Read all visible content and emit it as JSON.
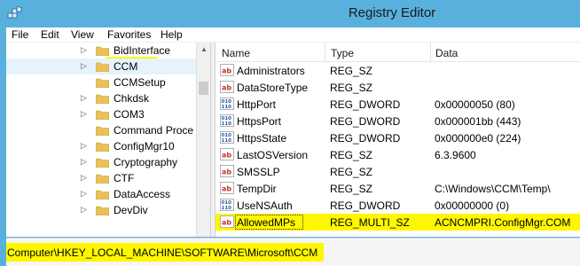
{
  "window": {
    "title": "Registry Editor"
  },
  "menu": [
    "File",
    "Edit",
    "View",
    "Favorites",
    "Help"
  ],
  "tree": {
    "items": [
      {
        "label": "BidInterface",
        "expandable": true,
        "selected": false
      },
      {
        "label": "CCM",
        "expandable": true,
        "selected": true
      },
      {
        "label": "CCMSetup",
        "expandable": false,
        "selected": false
      },
      {
        "label": "Chkdsk",
        "expandable": true,
        "selected": false
      },
      {
        "label": "COM3",
        "expandable": true,
        "selected": false
      },
      {
        "label": "Command Proce",
        "expandable": false,
        "selected": false
      },
      {
        "label": "ConfigMgr10",
        "expandable": true,
        "selected": false
      },
      {
        "label": "Cryptography",
        "expandable": true,
        "selected": false
      },
      {
        "label": "CTF",
        "expandable": true,
        "selected": false
      },
      {
        "label": "DataAccess",
        "expandable": true,
        "selected": false
      },
      {
        "label": "DevDiv",
        "expandable": true,
        "selected": false
      }
    ]
  },
  "list": {
    "columns": [
      "Name",
      "Type",
      "Data"
    ],
    "rows": [
      {
        "icon": "string-value-icon",
        "name": "Administrators",
        "type": "REG_SZ",
        "data": ""
      },
      {
        "icon": "string-value-icon",
        "name": "DataStoreType",
        "type": "REG_SZ",
        "data": ""
      },
      {
        "icon": "dword-value-icon",
        "name": "HttpPort",
        "type": "REG_DWORD",
        "data": "0x00000050 (80)"
      },
      {
        "icon": "dword-value-icon",
        "name": "HttpsPort",
        "type": "REG_DWORD",
        "data": "0x000001bb (443)"
      },
      {
        "icon": "dword-value-icon",
        "name": "HttpsState",
        "type": "REG_DWORD",
        "data": "0x000000e0 (224)"
      },
      {
        "icon": "string-value-icon",
        "name": "LastOSVersion",
        "type": "REG_SZ",
        "data": "6.3.9600"
      },
      {
        "icon": "string-value-icon",
        "name": "SMSSLP",
        "type": "REG_SZ",
        "data": ""
      },
      {
        "icon": "string-value-icon",
        "name": "TempDir",
        "type": "REG_SZ",
        "data": "C:\\Windows\\CCM\\Temp\\"
      },
      {
        "icon": "dword-value-icon",
        "name": "UseNSAuth",
        "type": "REG_DWORD",
        "data": "0x00000000 (0)"
      },
      {
        "icon": "string-value-icon",
        "name": "AllowedMPs",
        "type": "REG_MULTI_SZ",
        "data": "ACNCMPRI.ConfigMgr.COM",
        "highlighted": true
      }
    ]
  },
  "status": {
    "path": "Computer\\HKEY_LOCAL_MACHINE\\SOFTWARE\\Microsoft\\CCM"
  },
  "colors": {
    "title_bg": "#5ab0dd",
    "highlight": "#fff700",
    "selection": "#e5f3fb",
    "folder": "#e8c15a",
    "string_icon": "#c0392b",
    "dword_icon": "#2a5fa8"
  }
}
